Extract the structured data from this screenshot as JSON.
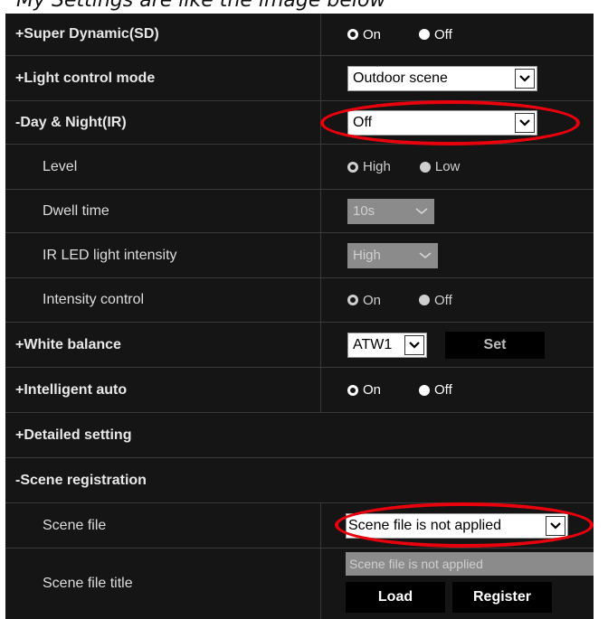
{
  "caption": "My Settings are like the image below",
  "rows": {
    "super_dynamic": {
      "label": "+Super Dynamic(SD)",
      "on": "On",
      "off": "Off"
    },
    "light_control": {
      "label": "+Light control mode",
      "value": "Outdoor scene"
    },
    "day_night": {
      "label": "-Day & Night(IR)",
      "value": "Off"
    },
    "level": {
      "label": "Level",
      "high": "High",
      "low": "Low"
    },
    "dwell_time": {
      "label": "Dwell time",
      "value": "10s"
    },
    "ir_led": {
      "label": "IR LED light intensity",
      "value": "High"
    },
    "intensity_control": {
      "label": "Intensity control",
      "on": "On",
      "off": "Off"
    },
    "white_balance": {
      "label": "+White balance",
      "value": "ATW1",
      "set": "Set"
    },
    "intelligent_auto": {
      "label": "+Intelligent auto",
      "on": "On",
      "off": "Off"
    },
    "detailed_setting": {
      "label": "+Detailed setting"
    },
    "scene_registration": {
      "label": "-Scene registration"
    },
    "scene_file": {
      "label": "Scene file",
      "value": "Scene file is not applied"
    },
    "scene_file_title": {
      "label": "Scene file title",
      "value": "Scene file is not applied",
      "load": "Load",
      "register": "Register"
    }
  },
  "colors": {
    "panel_bg": "#151515",
    "highlight_oval": "#e8000d"
  }
}
